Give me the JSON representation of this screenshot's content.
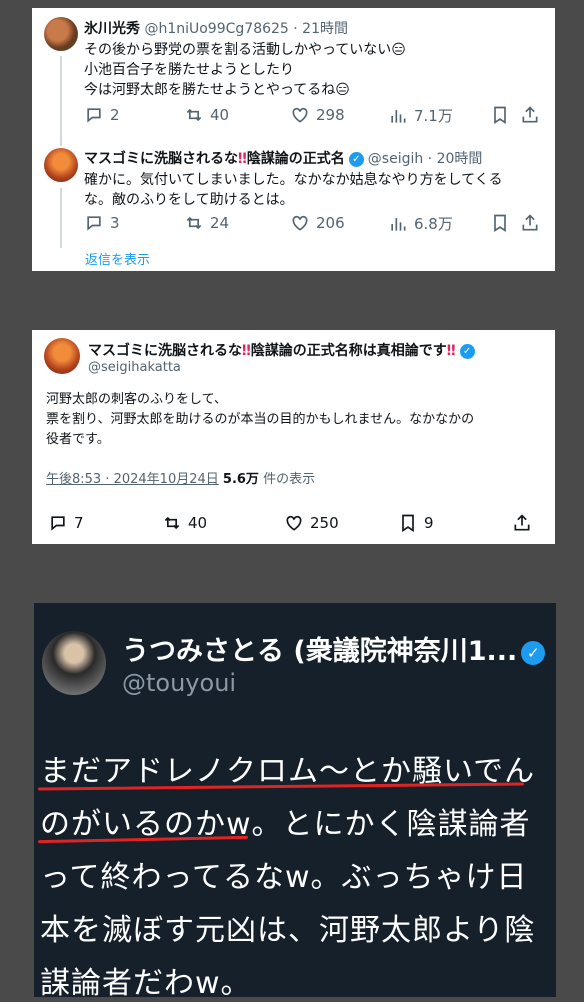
{
  "tweet1": {
    "name": "氷川光秀",
    "handle": "@h1niUo99Cg78625",
    "time": "· 21時間",
    "lines": [
      "その後から野党の票を割る活動しかやっていない😑",
      "小池百合子を勝たせようとしたり",
      "今は河野太郎を勝たせようとやってるね😑"
    ],
    "replies": "2",
    "retweets": "40",
    "likes": "298",
    "views": "7.1万"
  },
  "tweet2": {
    "name": "マスゴミに洗脳されるな",
    "name2": "陰謀論の正式名",
    "handle": "@seigih · 20時間",
    "lines": [
      "確かに。気付いてしまいました。なかなか姑息なやり方をしてくる",
      "な。敵のふりをして助けるとは。"
    ],
    "replies": "3",
    "retweets": "24",
    "likes": "206",
    "views": "6.8万",
    "show_replies": "返信を表示"
  },
  "tweet3": {
    "name": "マスゴミに洗脳されるな",
    "name2": "陰謀論の正式名称は真相論です",
    "handle": "@seigihakatta",
    "lines": [
      "河野太郎の刺客のふりをして、",
      "票を割り、河野太郎を助けるのが本当の目的かもしれません。なかなかの",
      "役者です。"
    ],
    "timestamp": "午後8:53 · 2024年10月24日",
    "views_num": "5.6万",
    "views_label": " 件の表示",
    "replies": "7",
    "retweets": "40",
    "likes": "250",
    "bookmarks": "9"
  },
  "tweet4": {
    "name": "うつみさとる (衆議院神奈川1...",
    "handle": "@touyoui",
    "lines": [
      "まだアドレノクロム〜とか騒いでん",
      "のがいるのかw。とにかく陰謀論者",
      "って終わってるなw。ぶっちゃけ日",
      "本を滅ぼす元凶は、河野太郎より陰",
      "謀論者だわw。"
    ]
  }
}
